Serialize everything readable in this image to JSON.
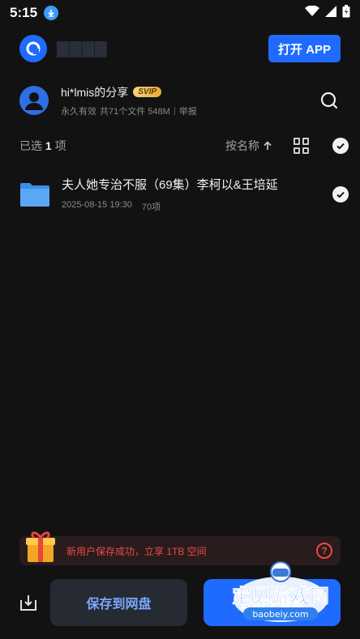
{
  "status": {
    "time": "5:15"
  },
  "header": {
    "open_app_label": "打开 APP"
  },
  "share": {
    "title": "hi*lmis的分享",
    "badge": "SVIP",
    "validity": "永久有效",
    "summary": "共71个文件 548M",
    "report": "举报"
  },
  "toolbar": {
    "selected_prefix": "已选",
    "selected_count": "1",
    "selected_suffix": "项",
    "sort_label": "按名称"
  },
  "files": [
    {
      "name": "夫人她专治不服（69集）李柯以&王培延",
      "date": "2025-08-15 19:30",
      "count": "70项",
      "selected": true
    }
  ],
  "banner": {
    "text": "新用户保存成功，立享 1TB 空间"
  },
  "bottom": {
    "save_label": "保存到网盘",
    "primary_label": "去APP查看"
  },
  "watermark": {
    "text": "宝贝游戏网",
    "url": "baobeiy.com"
  },
  "colors": {
    "accent": "#1f6bff",
    "background": "#121212",
    "alert": "#e84a4a"
  }
}
